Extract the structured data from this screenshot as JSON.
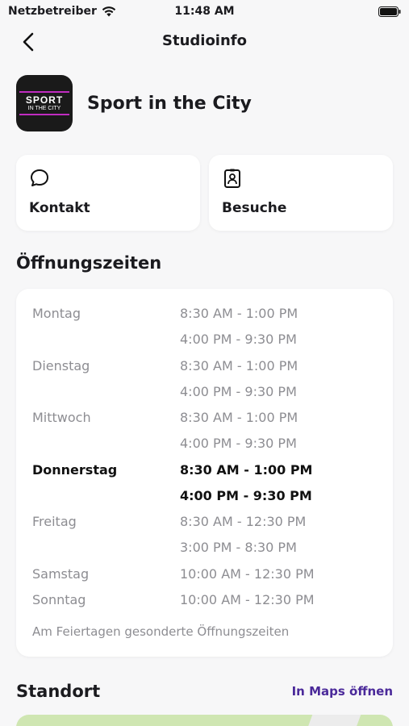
{
  "status_bar": {
    "carrier": "Netzbetreiber",
    "time": "11:48 AM"
  },
  "nav": {
    "title": "Studioinfo"
  },
  "studio": {
    "name": "Sport in the City",
    "logo_line1": "SPORT",
    "logo_line2": "IN THE CITY"
  },
  "actions": [
    {
      "label": "Kontakt",
      "icon": "chat-bubble-icon"
    },
    {
      "label": "Besuche",
      "icon": "id-badge-icon"
    }
  ],
  "opening_hours": {
    "title": "Öffnungszeiten",
    "rows": [
      {
        "day": "Montag",
        "time": "8:30 AM - 1:00 PM"
      },
      {
        "day": "",
        "time": "4:00 PM - 9:30 PM"
      },
      {
        "day": "Dienstag",
        "time": "8:30 AM - 1:00 PM"
      },
      {
        "day": "",
        "time": "4:00 PM - 9:30 PM"
      },
      {
        "day": "Mittwoch",
        "time": "8:30 AM - 1:00 PM"
      },
      {
        "day": "",
        "time": "4:00 PM - 9:30 PM"
      },
      {
        "day": "Donnerstag",
        "time": "8:30 AM - 1:00 PM"
      },
      {
        "day": "",
        "time": "4:00 PM - 9:30 PM"
      },
      {
        "day": "Freitag",
        "time": "8:30 AM - 12:30 PM"
      },
      {
        "day": "",
        "time": "3:00 PM - 8:30 PM"
      },
      {
        "day": "Samstag",
        "time": "10:00 AM - 12:30 PM"
      },
      {
        "day": "Sonntag",
        "time": "10:00 AM - 12:30 PM"
      }
    ],
    "holiday_note": "Am Feiertagen gesonderte Öffnungszeiten"
  },
  "location": {
    "title": "Standort",
    "maps_link": "In Maps öffnen"
  },
  "colors": {
    "accent": "#4b2a9a",
    "today": "#111111",
    "muted": "#8d8d92"
  }
}
